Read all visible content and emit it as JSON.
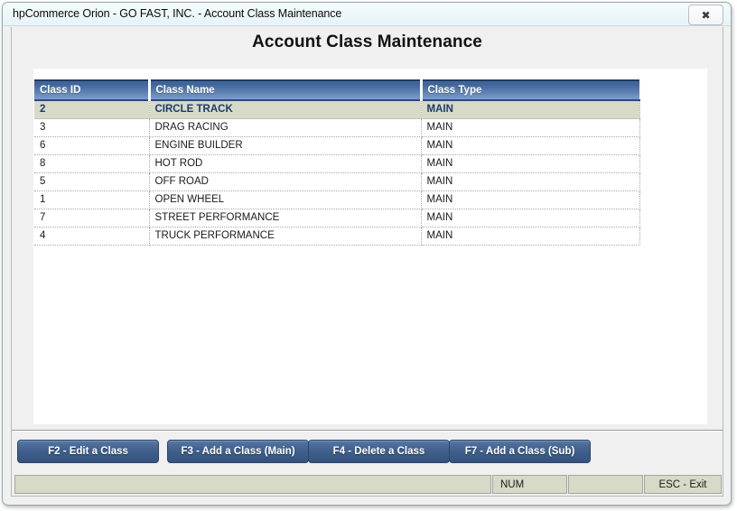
{
  "window": {
    "title": "hpCommerce Orion - GO FAST, INC. - Account Class Maintenance",
    "close_glyph": "✖"
  },
  "page": {
    "title": "Account Class Maintenance"
  },
  "grid": {
    "columns": [
      "Class ID",
      "Class Name",
      "Class Type"
    ],
    "rows": [
      {
        "id": "2",
        "name": "CIRCLE TRACK",
        "type": "MAIN",
        "selected": true
      },
      {
        "id": "3",
        "name": "DRAG RACING",
        "type": "MAIN",
        "selected": false
      },
      {
        "id": "6",
        "name": "ENGINE BUILDER",
        "type": "MAIN",
        "selected": false
      },
      {
        "id": "8",
        "name": "HOT ROD",
        "type": "MAIN",
        "selected": false
      },
      {
        "id": "5",
        "name": "OFF ROAD",
        "type": "MAIN",
        "selected": false
      },
      {
        "id": "1",
        "name": "OPEN WHEEL",
        "type": "MAIN",
        "selected": false
      },
      {
        "id": "7",
        "name": "STREET PERFORMANCE",
        "type": "MAIN",
        "selected": false
      },
      {
        "id": "4",
        "name": "TRUCK PERFORMANCE",
        "type": "MAIN",
        "selected": false
      }
    ]
  },
  "buttons": [
    {
      "label": "F2 - Edit a Class"
    },
    {
      "label": "F3 - Add a Class (Main)"
    },
    {
      "label": "F4 - Delete a Class"
    },
    {
      "label": "F7 - Add a Class (Sub)"
    }
  ],
  "statusbar": {
    "cells": [
      "",
      "NUM",
      "",
      "ESC - Exit"
    ]
  },
  "colors": {
    "header_blue": "#46699c",
    "selected_row_bg": "#d6dac6",
    "selected_row_text": "#1c3a6b",
    "button_blue": "#3d5d8a",
    "titlebar": "#eef8fb"
  }
}
